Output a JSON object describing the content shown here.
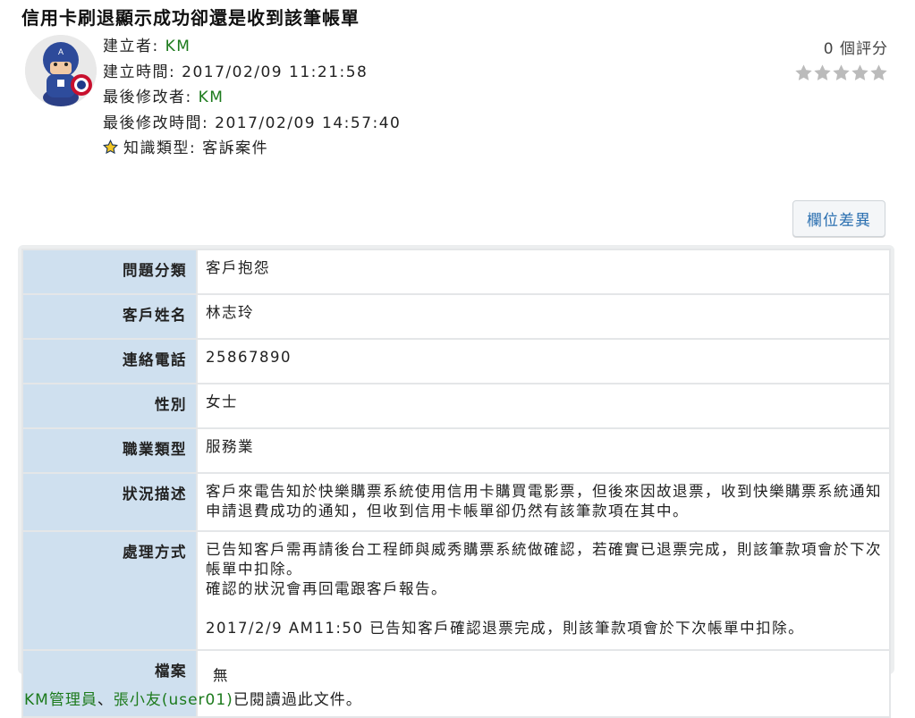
{
  "title": "信用卡刷退顯示成功卻還是收到該筆帳單",
  "meta": {
    "creator_label": "建立者:",
    "creator": "KM",
    "created_label": "建立時間:",
    "created": "2017/02/09 11:21:58",
    "modifier_label": "最後修改者:",
    "modifier": "KM",
    "modified_label": "最後修改時間:",
    "modified": "2017/02/09 14:57:40",
    "type_label": "知識類型:",
    "type": "客訴案件"
  },
  "rating": {
    "count_text": "0 個評分",
    "value": 0,
    "max": 5,
    "star_color": "#bbbbbb"
  },
  "diff_button": "欄位差異",
  "fields": [
    {
      "key": "問題分類",
      "value": "客戶抱怨"
    },
    {
      "key": "客戶姓名",
      "value": "林志玲"
    },
    {
      "key": "連絡電話",
      "value": "25867890"
    },
    {
      "key": "性別",
      "value": "女士"
    },
    {
      "key": "職業類型",
      "value": "服務業"
    },
    {
      "key": "狀況描述",
      "value": "客戶來電告知於快樂購票系統使用信用卡購買電影票，但後來因故退票，收到快樂購票系統通知申請退費成功的通知，但收到信用卡帳單卻仍然有該筆款項在其中。"
    },
    {
      "key": "處理方式",
      "lines": [
        "已告知客戶需再請後台工程師與威秀購票系統做確認，若確實已退票完成，則該筆款項會於下次帳單中扣除。",
        "確認的狀況會再回電跟客戶報告。",
        "",
        "2017/2/9 AM11:50 已告知客戶確認退票完成，則該筆款項會於下次帳單中扣除。"
      ]
    },
    {
      "key": "檔案",
      "value": "無"
    }
  ],
  "footer": {
    "reader1": "KM管理員",
    "sep": "、",
    "reader2": "張小友(user01)",
    "suffix": "已閱讀過此文件。"
  },
  "colors": {
    "accent_green": "#1c7a1c",
    "link_blue": "#2a6fb0",
    "key_cell_bg": "#cfe0ef"
  }
}
